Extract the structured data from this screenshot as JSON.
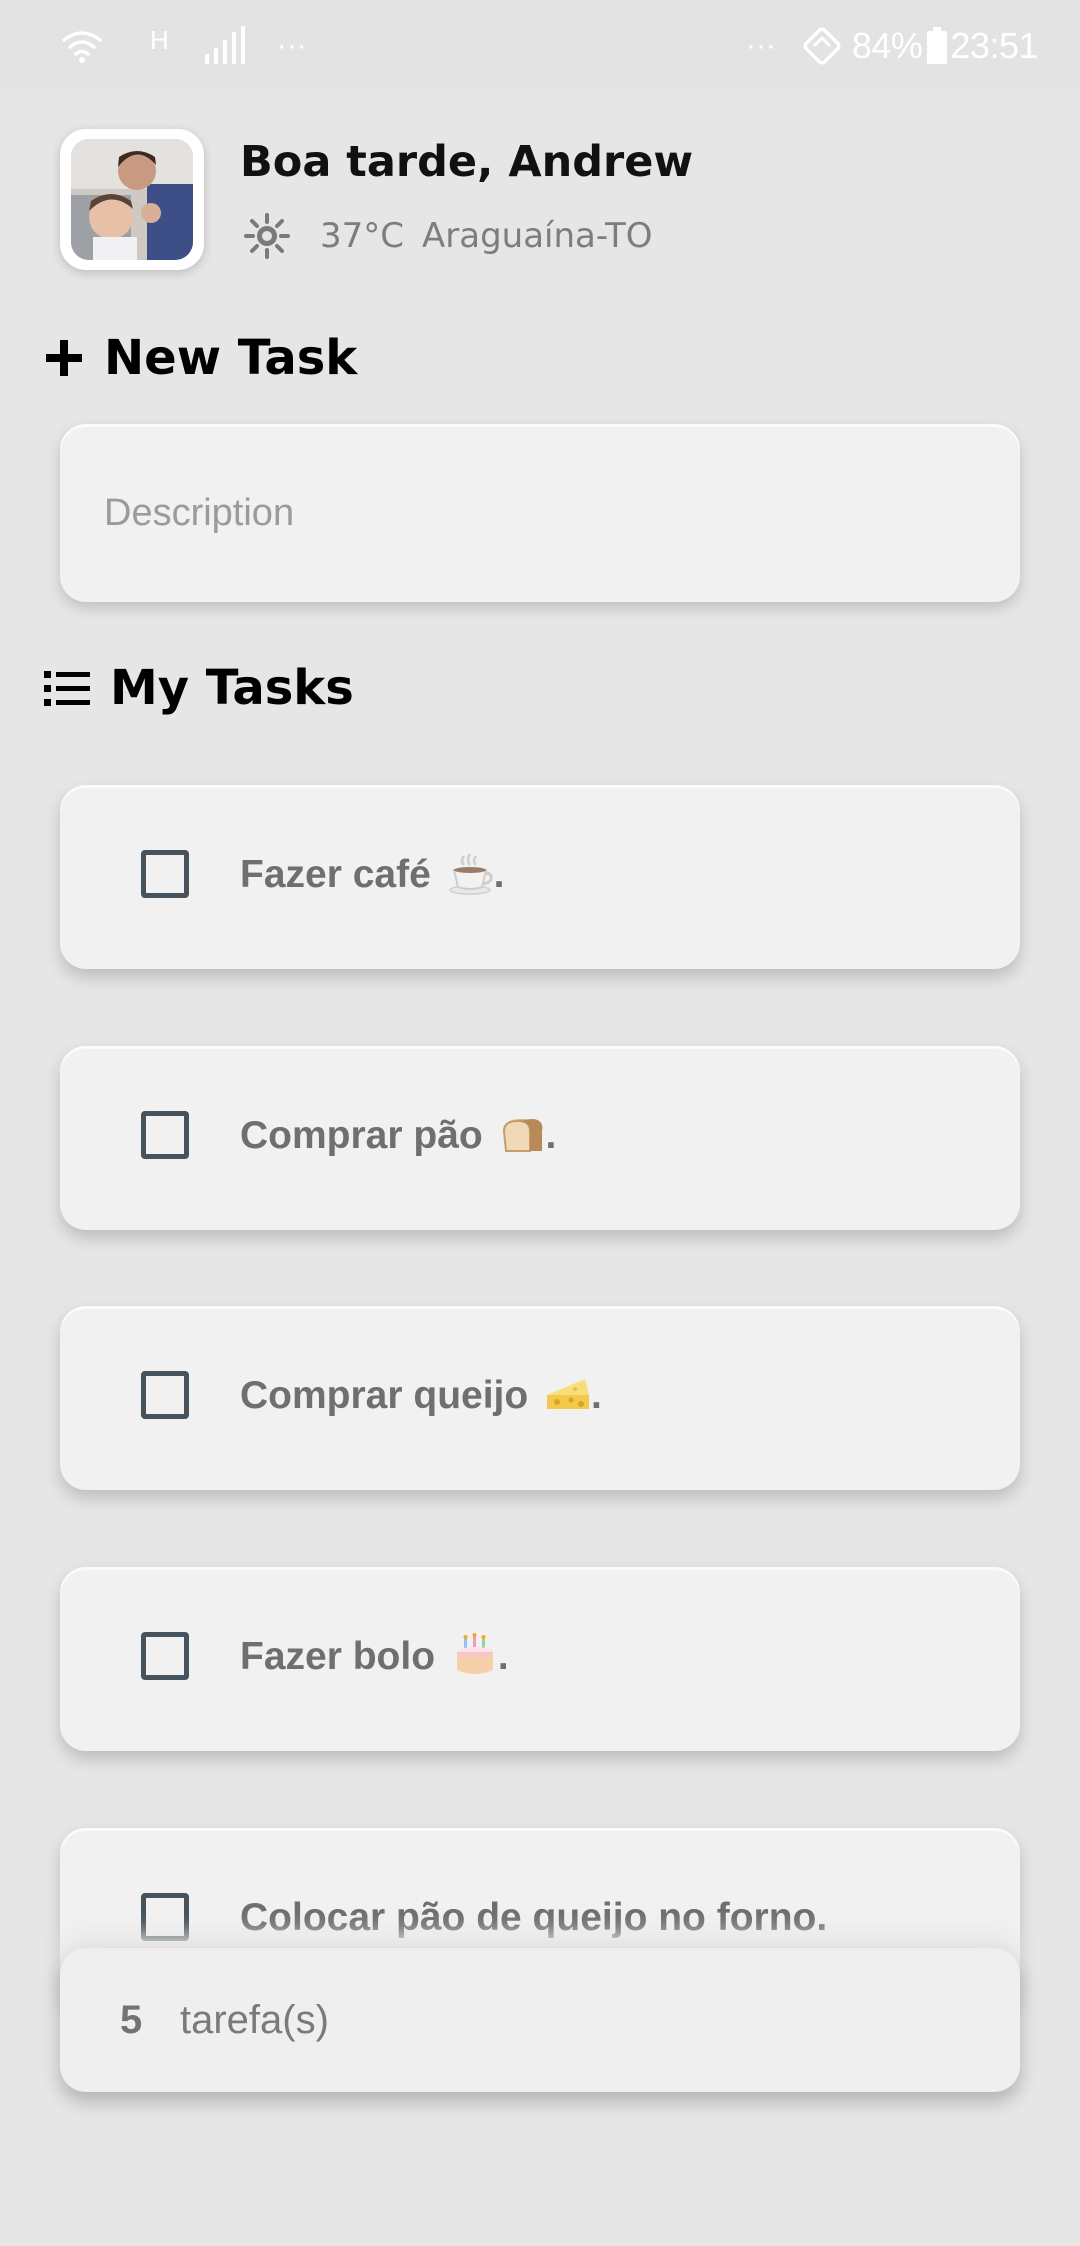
{
  "status_bar": {
    "network_type": "H",
    "left_dots": "···",
    "right_dots": "···",
    "battery": "84%",
    "time": "23:51",
    "icons": [
      "wifi-icon",
      "h-network-icon",
      "signal-icon",
      "nfc-icon",
      "battery-icon"
    ]
  },
  "header": {
    "greeting": "Boa tarde, Andrew",
    "temperature": "37°C",
    "city": "Araguaína-TO",
    "weather_icon": "sun-icon"
  },
  "new_task": {
    "title": "New Task",
    "title_icon": "plus-icon",
    "input_value": "",
    "input_placeholder": "Description"
  },
  "my_tasks": {
    "title": "My Tasks",
    "title_icon": "list-icon",
    "items": [
      {
        "text": "Fazer café",
        "emoji_icon": "coffee-icon",
        "suffix": ".",
        "done": false
      },
      {
        "text": "Comprar pão",
        "emoji_icon": "bread-icon",
        "suffix": ".",
        "done": false
      },
      {
        "text": "Comprar queijo",
        "emoji_icon": "cheese-icon",
        "suffix": ".",
        "done": false
      },
      {
        "text": "Fazer bolo",
        "emoji_icon": "cake-icon",
        "suffix": ".",
        "done": false
      },
      {
        "text": "Colocar pão de queijo no forno.",
        "emoji_icon": "",
        "suffix": "",
        "done": false
      }
    ]
  },
  "footer": {
    "count": "5",
    "label": "tarefa(s)"
  },
  "colors": {
    "background": "#e6e6e6",
    "card": "#f1f1f1",
    "checkbox_border": "#47535c",
    "task_text": "#6f6f6f",
    "muted_text": "#7d7d7d"
  }
}
